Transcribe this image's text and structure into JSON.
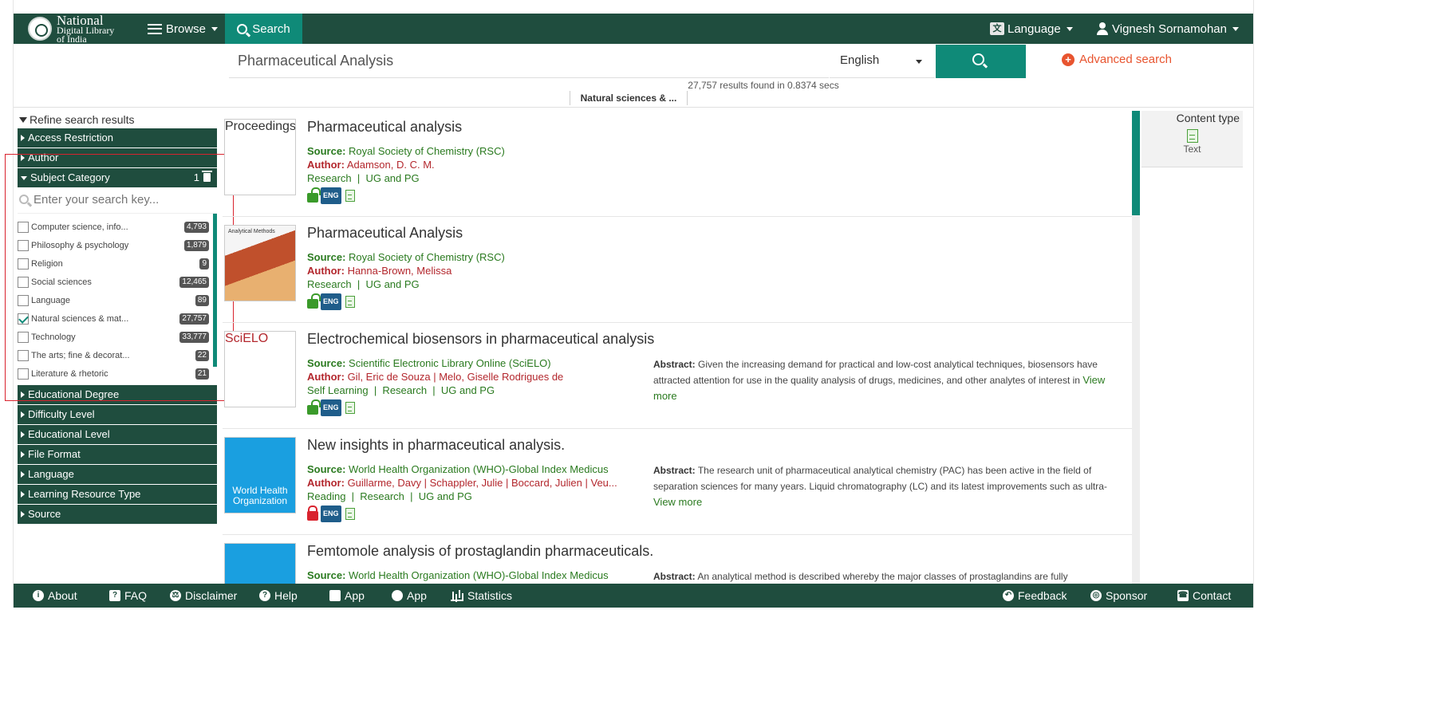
{
  "colors": {
    "nav": "#1f4d3e",
    "accent": "#0f8a78",
    "source": "#2a7a1f",
    "author": "#b3272d",
    "advanced": "#e8542f"
  },
  "header": {
    "brand_line1": "National",
    "brand_line2": "Digital Library",
    "brand_line3": "of India",
    "browse_label": "Browse",
    "search_tab_label": "Search",
    "language_label": "Language",
    "user_name": "Vignesh Sornamohan"
  },
  "search": {
    "query": "Pharmaceutical Analysis",
    "language": "English",
    "advanced_label": "Advanced search",
    "results_text": "27,757 results found in 0.8374 secs",
    "breadcrumb": "Natural sciences & ..."
  },
  "sidebar": {
    "refine_label": "Refine search results",
    "facets_top": [
      "Access Restriction",
      "Author"
    ],
    "subject": {
      "label": "Subject Category",
      "selected_count": "1",
      "placeholder": "Enter your search key...",
      "items": [
        {
          "label": "Computer science, info...",
          "count": "4,793",
          "checked": false
        },
        {
          "label": "Philosophy & psychology",
          "count": "1,879",
          "checked": false
        },
        {
          "label": "Religion",
          "count": "9",
          "checked": false
        },
        {
          "label": "Social sciences",
          "count": "12,465",
          "checked": false
        },
        {
          "label": "Language",
          "count": "89",
          "checked": false
        },
        {
          "label": "Natural sciences & mat...",
          "count": "27,757",
          "checked": true
        },
        {
          "label": "Technology",
          "count": "33,777",
          "checked": false
        },
        {
          "label": "The arts; fine & decorat...",
          "count": "22",
          "checked": false
        },
        {
          "label": "Literature & rhetoric",
          "count": "21",
          "checked": false
        }
      ]
    },
    "facets_bottom": [
      "Educational Degree",
      "Difficulty Level",
      "Educational Level",
      "File Format",
      "Language",
      "Learning Resource Type",
      "Source"
    ]
  },
  "results": [
    {
      "title": "Pharmaceutical analysis",
      "source_label": "Source:",
      "source": "Royal Society of Chemistry (RSC)",
      "author_label": "Author:",
      "author": "Adamson, D. C. M.",
      "edu": "Research  |  UG and PG",
      "access": "open",
      "lang": "ENG",
      "thumb": "Proceedings"
    },
    {
      "title": "Pharmaceutical Analysis",
      "source_label": "Source:",
      "source": "Royal Society of Chemistry (RSC)",
      "author_label": "Author:",
      "author": "Hanna-Brown, Melissa",
      "edu": "Research  |  UG and PG",
      "access": "open",
      "lang": "ENG",
      "thumb": "Analytical Methods"
    },
    {
      "title": "Electrochemical biosensors in pharmaceutical analysis",
      "source_label": "Source:",
      "source": "Scientific Electronic Library Online (SciELO)",
      "author_label": "Author:",
      "author": "Gil, Eric de Souza | Melo, Giselle Rodrigues de",
      "edu": "Self Learning  |  Research  |  UG and PG",
      "access": "open",
      "lang": "ENG",
      "abstract_label": "Abstract:",
      "abstract": "Given the increasing demand for practical and low-cost analytical techniques, biosensors have attracted attention for use in the quality analysis of drugs, medicines, and other analytes of interest in",
      "view_more": "View more",
      "thumb": "SciELO"
    },
    {
      "title": "New insights in pharmaceutical analysis.",
      "source_label": "Source:",
      "source": "World Health Organization (WHO)-Global Index Medicus",
      "author_label": "Author:",
      "author": "Guillarme, Davy | Schappler, Julie | Boccard, Julien | Veu...",
      "edu": "Reading  |  Research  |  UG and PG",
      "access": "closed",
      "lang": "ENG",
      "abstract_label": "Abstract:",
      "abstract": "The research unit of pharmaceutical analytical chemistry (PAC) has been active in the field of separation sciences for many years. Liquid chromatography (LC) and its latest improvements such as ultra-",
      "view_more": "View more",
      "thumb": "World Health Organization"
    },
    {
      "title": "Femtomole analysis of prostaglandin pharmaceuticals.",
      "source_label": "Source:",
      "source": "World Health Organization (WHO)-Global Index Medicus",
      "abstract_label": "Abstract:",
      "abstract": "An analytical method is described whereby the major classes of prostaglandins are fully"
    }
  ],
  "content_type": {
    "title": "Content type",
    "item": "Text"
  },
  "footer": {
    "about": "About",
    "faq": "FAQ",
    "disclaimer": "Disclaimer",
    "help": "Help",
    "app_android": "App",
    "app_ios": "App",
    "statistics": "Statistics",
    "feedback": "Feedback",
    "sponsor": "Sponsor",
    "contact": "Contact"
  }
}
